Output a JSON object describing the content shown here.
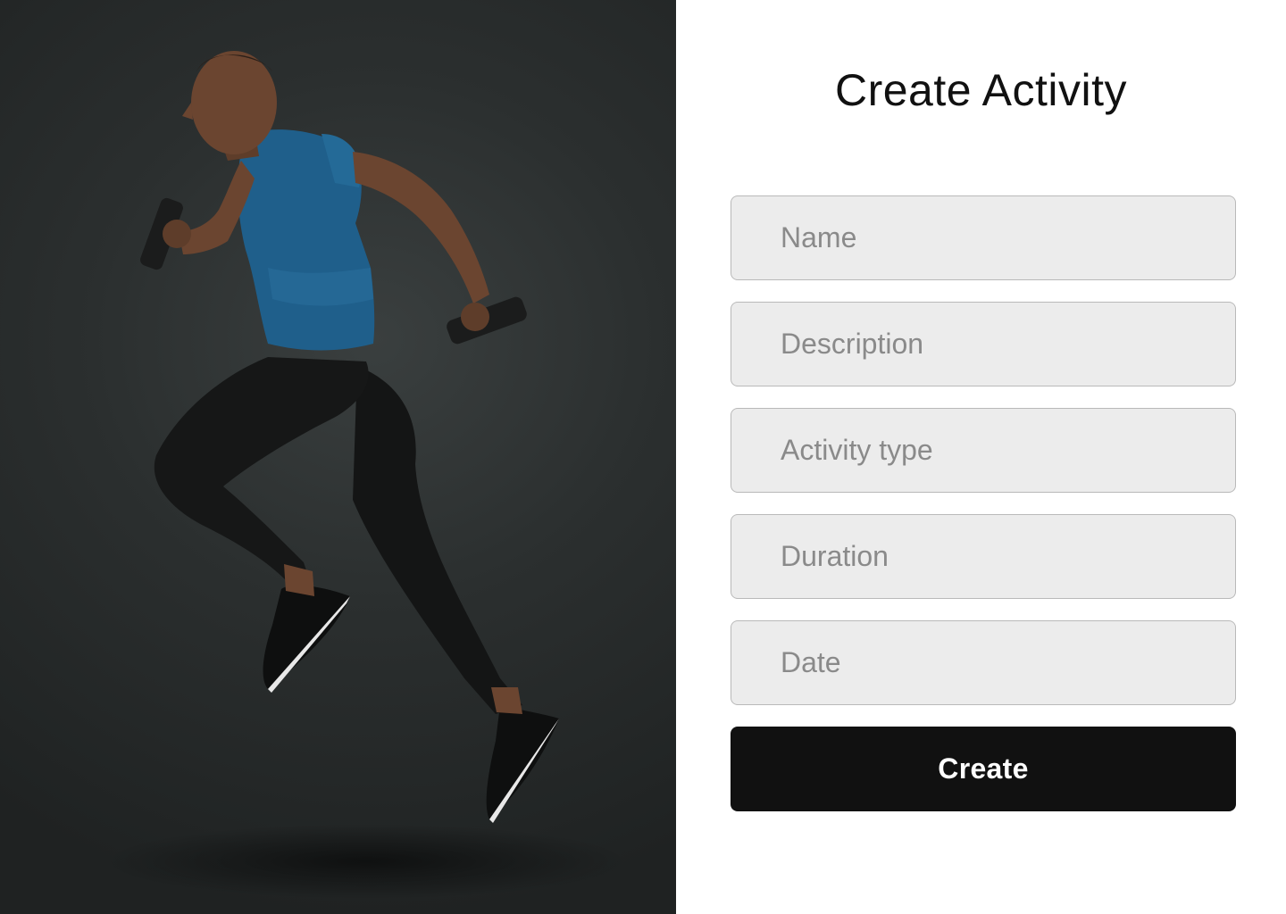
{
  "form": {
    "title": "Create Activity",
    "fields": [
      {
        "placeholder": "Name",
        "value": ""
      },
      {
        "placeholder": "Description",
        "value": ""
      },
      {
        "placeholder": "Activity type",
        "value": ""
      },
      {
        "placeholder": "Duration",
        "value": ""
      },
      {
        "placeholder": "Date",
        "value": ""
      }
    ],
    "submit_label": "Create"
  },
  "hero": {
    "image_subject": "athlete-running-with-dumbbells"
  },
  "colors": {
    "button_bg": "#111111",
    "field_bg": "#ececec",
    "shirt_blue": "#1f5f8b",
    "hero_bg": "#2b2f2f"
  }
}
